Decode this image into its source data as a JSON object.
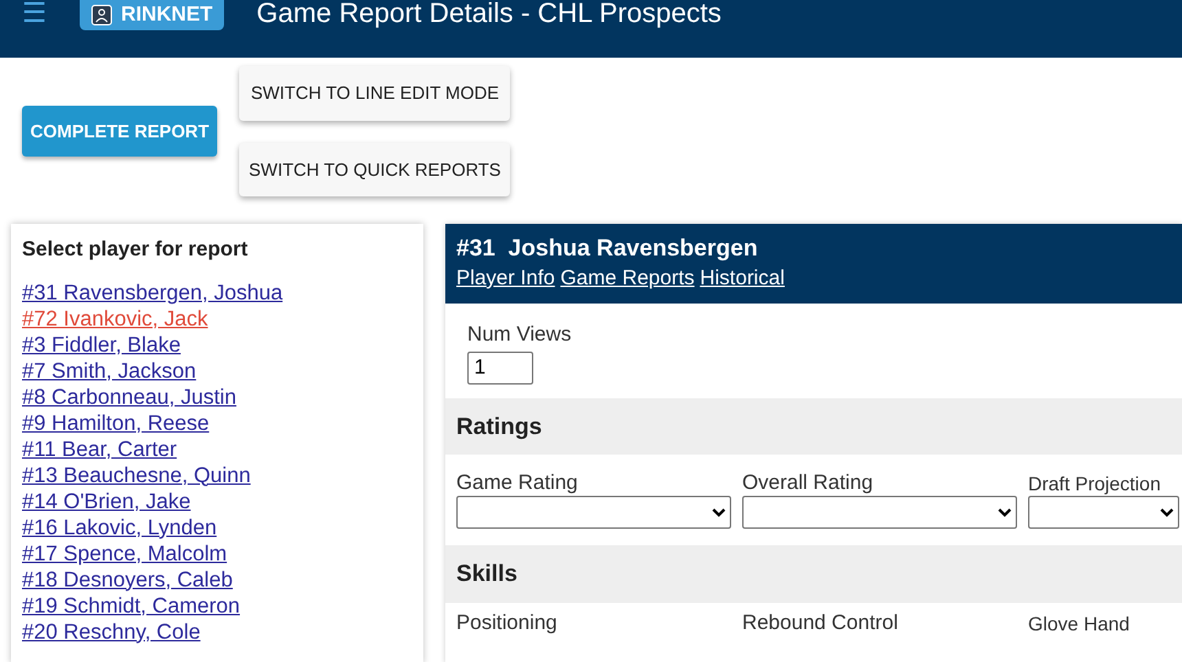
{
  "header": {
    "menu_glyph": "☰",
    "logo_text": "RINKNET",
    "title": "Game Report Details - CHL Prospects"
  },
  "actions": {
    "primary": "COMPLETE REPORT",
    "secondary": [
      "SWITCH TO LINE EDIT MODE",
      "SWITCH TO QUICK REPORTS"
    ]
  },
  "player_list": {
    "title": "Select player for report",
    "players": [
      {
        "label": "#31 Ravensbergen, Joshua",
        "hovered": false
      },
      {
        "label": "#72 Ivankovic, Jack",
        "hovered": true
      },
      {
        "label": "#3 Fiddler, Blake",
        "hovered": false
      },
      {
        "label": "#7 Smith, Jackson",
        "hovered": false
      },
      {
        "label": "#8 Carbonneau, Justin",
        "hovered": false
      },
      {
        "label": "#9 Hamilton, Reese",
        "hovered": false
      },
      {
        "label": "#11 Bear, Carter",
        "hovered": false
      },
      {
        "label": "#13 Beauchesne, Quinn",
        "hovered": false
      },
      {
        "label": "#14 O'Brien, Jake",
        "hovered": false
      },
      {
        "label": "#16 Lakovic, Lynden",
        "hovered": false
      },
      {
        "label": "#17 Spence, Malcolm",
        "hovered": false
      },
      {
        "label": "#18 Desnoyers, Caleb",
        "hovered": false
      },
      {
        "label": "#19 Schmidt, Cameron",
        "hovered": false
      },
      {
        "label": "#20 Reschny, Cole",
        "hovered": false
      }
    ]
  },
  "report": {
    "number": "#31",
    "name": "Joshua Ravensbergen",
    "links": [
      "Player Info",
      "Game Reports",
      "Historical"
    ],
    "num_views": {
      "label": "Num Views",
      "value": "1"
    },
    "sections": [
      {
        "title": "Ratings",
        "fields": [
          "Game Rating",
          "Overall Rating",
          "Draft Projection"
        ]
      },
      {
        "title": "Skills",
        "fields": [
          "Positioning",
          "Rebound Control",
          "Glove Hand"
        ]
      }
    ]
  }
}
